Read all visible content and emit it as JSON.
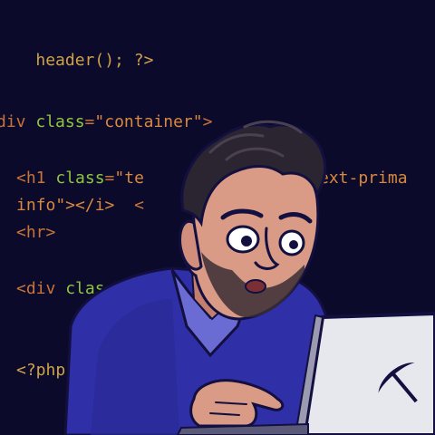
{
  "scene": {
    "description_colors": {
      "background": "#0b0a2a",
      "sweater": "#2f2fa8",
      "collar": "#6b6bd4",
      "skin": "#d99a86",
      "hair": "#2a2530",
      "laptop": "#e7e8ee"
    },
    "code": {
      "line1": "header(); ?>",
      "line2_tag": "div",
      "line2_attr": "class",
      "line2_eq": "=",
      "line2_str": "\"container\"",
      "line2_end": ">",
      "line3_tag": "<h1",
      "line3_attr": "class",
      "line3_eq": "=",
      "line3_str1": "\"te",
      "line3_str2": "ext-prima",
      "line4_str": "info\"></i>",
      "line4_tail": "<",
      "line5": "<hr>",
      "line6_tag": "<div",
      "line6_attr": "clas",
      "line7": "<?php"
    },
    "laptop_logo": "pickaxe-icon"
  }
}
